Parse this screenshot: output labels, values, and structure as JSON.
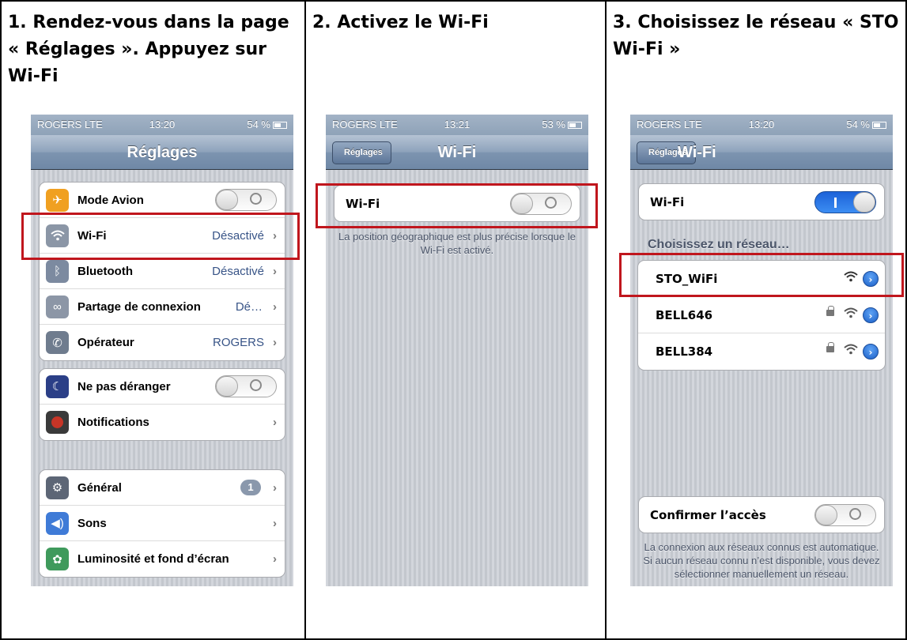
{
  "captions": {
    "step1": "1. Rendez-vous dans la page\n« Réglages ». Appuyez sur\nWi-Fi",
    "step2": "2. Activez le Wi-Fi",
    "step3": "3. Choisissez le réseau « STO\nWi-Fi »"
  },
  "status_bars": [
    {
      "carrier": "ROGERS LTE",
      "time": "13:20",
      "battery": "54 %"
    },
    {
      "carrier": "ROGERS LTE",
      "time": "13:21",
      "battery": "53 %"
    },
    {
      "carrier": "ROGERS LTE",
      "time": "13:20",
      "battery": "54 %"
    }
  ],
  "screen1": {
    "title": "Réglages",
    "group1": [
      {
        "label": "Mode Avion",
        "icon": "airplane-icon",
        "toggle": "off"
      },
      {
        "label": "Wi-Fi",
        "value": "Désactivé",
        "icon": "wifi-icon"
      },
      {
        "label": "Bluetooth",
        "value": "Désactivé",
        "icon": "bluetooth-icon"
      },
      {
        "label": "Partage de connexion",
        "value": "Dé…",
        "icon": "chain-link-icon"
      },
      {
        "label": "Opérateur",
        "value": "ROGERS",
        "icon": "phone-icon"
      }
    ],
    "group2": [
      {
        "label": "Ne pas déranger",
        "icon": "moon-icon",
        "toggle": "off"
      },
      {
        "label": "Notifications",
        "icon": "notifications-icon"
      }
    ],
    "group3": [
      {
        "label": "Général",
        "badge": "1",
        "icon": "gear-icon"
      },
      {
        "label": "Sons",
        "icon": "speaker-icon"
      },
      {
        "label": "Luminosité et fond d’écran",
        "icon": "flower-icon"
      }
    ]
  },
  "screen2": {
    "back": "Réglages",
    "title": "Wi-Fi",
    "wifi_label": "Wi-Fi",
    "note": "La position géographique est plus précise lorsque le Wi-Fi est activé."
  },
  "screen3": {
    "back": "Réglages",
    "title": "Wi-Fi",
    "wifi_label": "Wi-Fi",
    "choose_header": "Choisissez un réseau…",
    "networks": [
      {
        "name": "STO_WiFi",
        "locked": false
      },
      {
        "name": "BELL646",
        "locked": true
      },
      {
        "name": "BELL384",
        "locked": true
      }
    ],
    "confirm_label": "Confirmer l’accès",
    "confirm_note": "La connexion aux réseaux connus est automatique. Si aucun réseau connu n’est disponible, vous devez sélectionner manuellement un réseau."
  },
  "colors": {
    "highlight": "#c0161d",
    "airplane": "#f0a021",
    "wifi": "#8b96a6",
    "bluetooth": "#7c8aa0",
    "link": "#8c96a6",
    "phone": "#6f7c8e",
    "moon": "#2b3f87",
    "notifications": "#c73527",
    "gear": "#5d6676",
    "speaker": "#3f7bd7",
    "flower": "#3f9a5c"
  }
}
